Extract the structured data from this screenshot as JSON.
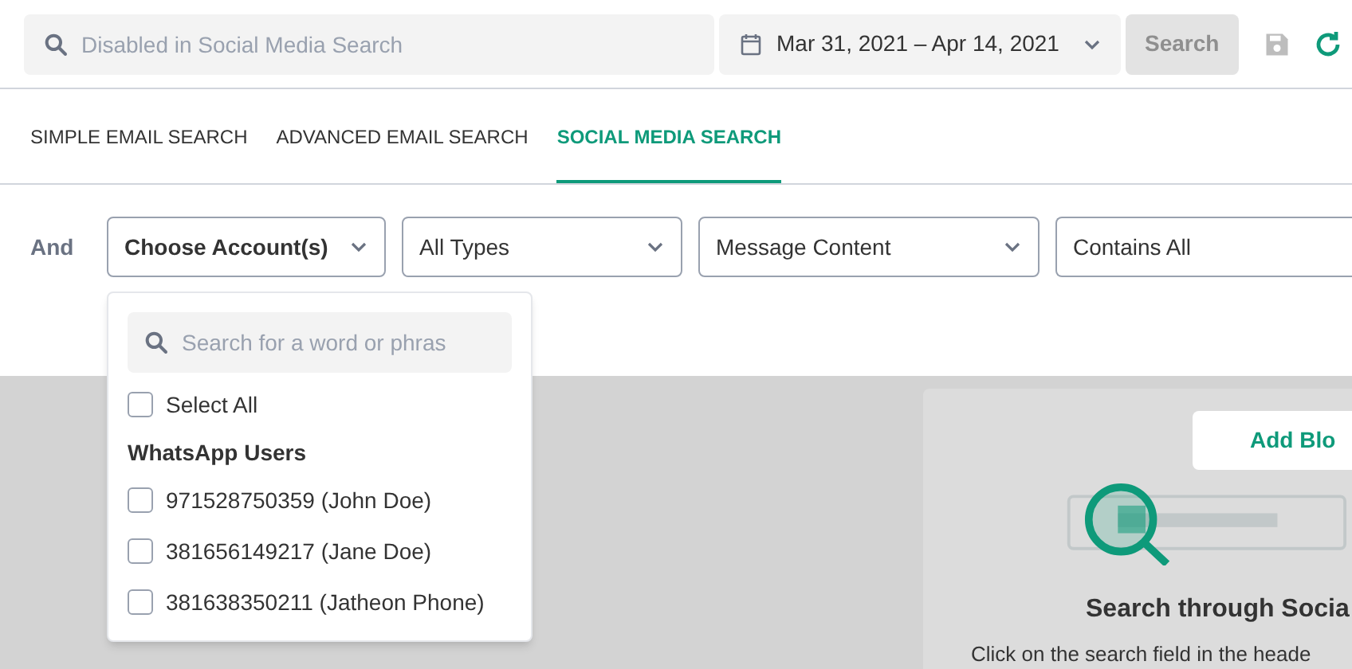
{
  "header": {
    "search": {
      "placeholder": "Disabled in Social Media Search",
      "disabled": true
    },
    "date_range": "Mar 31, 2021 – Apr 14, 2021",
    "search_button": {
      "label": "Search",
      "disabled": true
    }
  },
  "tabs": [
    {
      "label": "SIMPLE EMAIL SEARCH",
      "selected": false
    },
    {
      "label": "ADVANCED EMAIL SEARCH",
      "selected": false
    },
    {
      "label": "SOCIAL MEDIA SEARCH",
      "selected": true
    }
  ],
  "filter": {
    "operator": "And",
    "dropdowns": [
      {
        "label": "Choose Account(s)",
        "expanded": true
      },
      {
        "label": "All Types",
        "expanded": false
      },
      {
        "label": "Message Content",
        "expanded": false
      }
    ],
    "condition": "Contains All"
  },
  "account_menu": {
    "search": {
      "placeholder": "Search for a word or phras"
    },
    "select_all": {
      "label": "Select All",
      "checked": false
    },
    "group": "WhatsApp Users",
    "accounts": [
      {
        "label": "971528750359 (John Doe)",
        "checked": false
      },
      {
        "label": "381656149217 (Jane Doe)",
        "checked": false
      },
      {
        "label": "381638350211 (Jatheon Phone)",
        "checked": false
      }
    ]
  },
  "empty_state": {
    "button": "Add Blo",
    "title": "Search through Socia",
    "text": "Click on the search field in the heade"
  }
}
